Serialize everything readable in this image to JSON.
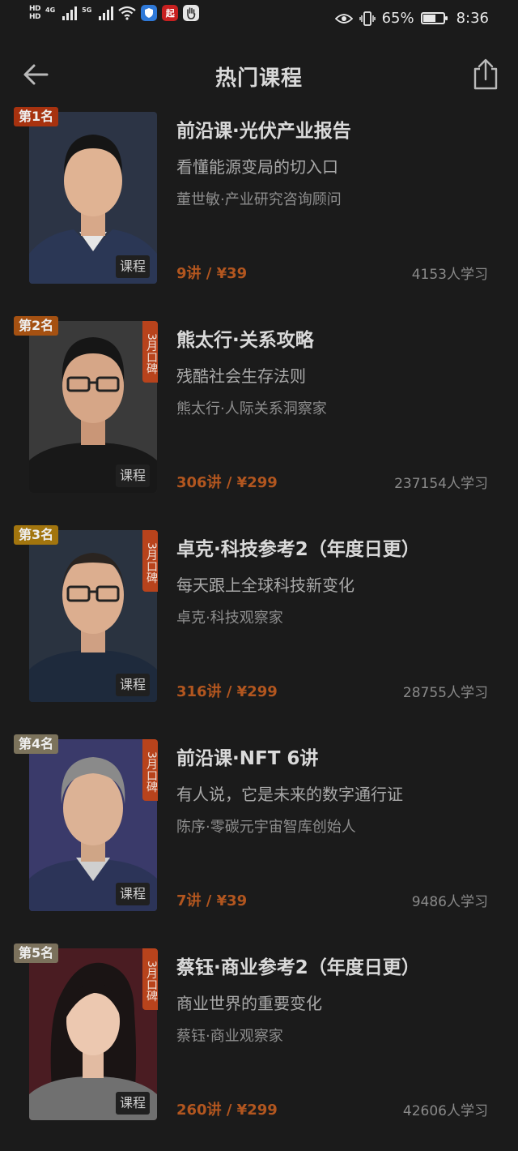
{
  "status_bar": {
    "hd1": "HD",
    "hd2": "HD",
    "net1": "4G",
    "net2": "5G",
    "app_icon_label": "起",
    "battery_percent": "65%",
    "battery_level": 0.65,
    "time": "8:36"
  },
  "header": {
    "title": "热门课程"
  },
  "courses": [
    {
      "rank": "第1名",
      "rank_color": "#a7320f",
      "rep_label": "",
      "type_tag": "课程",
      "title": "前沿课·光伏产业报告",
      "subtitle": "看懂能源变局的切入口",
      "author": "董世敏·产业研究咨询顾问",
      "price": "9讲 / ¥39",
      "learners": "4153人学习",
      "cover_bg": "#2c3445",
      "cover_shirt": "#2b3755"
    },
    {
      "rank": "第2名",
      "rank_color": "#a55112",
      "rep_label": "3月口碑",
      "type_tag": "课程",
      "title": "熊太行·关系攻略",
      "subtitle": "残酷社会生存法则",
      "author": "熊太行·人际关系洞察家",
      "price": "306讲 / ¥299",
      "learners": "237154人学习",
      "cover_bg": "#3a3a3a",
      "cover_shirt": "#181818"
    },
    {
      "rank": "第3名",
      "rank_color": "#a2750e",
      "rep_label": "3月口碑",
      "type_tag": "课程",
      "title": "卓克·科技参考2（年度日更）",
      "subtitle": "每天跟上全球科技新变化",
      "author": "卓克·科技观察家",
      "price": "316讲 / ¥299",
      "learners": "28755人学习",
      "cover_bg": "#2a3340",
      "cover_shirt": "#1e2a3c"
    },
    {
      "rank": "第4名",
      "rank_color": "#7c735c",
      "rep_label": "3月口碑",
      "type_tag": "课程",
      "title": "前沿课·NFT 6讲",
      "subtitle": "有人说，它是未来的数字通行证",
      "author": "陈序·零碳元宇宙智库创始人",
      "price": "7讲 / ¥39",
      "learners": "9486人学习",
      "cover_bg": "#3a3a6a",
      "cover_shirt": "#2c3458"
    },
    {
      "rank": "第5名",
      "rank_color": "#7b715c",
      "rep_label": "3月口碑",
      "type_tag": "课程",
      "title": "蔡钰·商业参考2（年度日更）",
      "subtitle": "商业世界的重要变化",
      "author": "蔡钰·商业观察家",
      "price": "260讲 / ¥299",
      "learners": "42606人学习",
      "cover_bg": "#4a1c22",
      "cover_shirt": "#707070"
    }
  ]
}
